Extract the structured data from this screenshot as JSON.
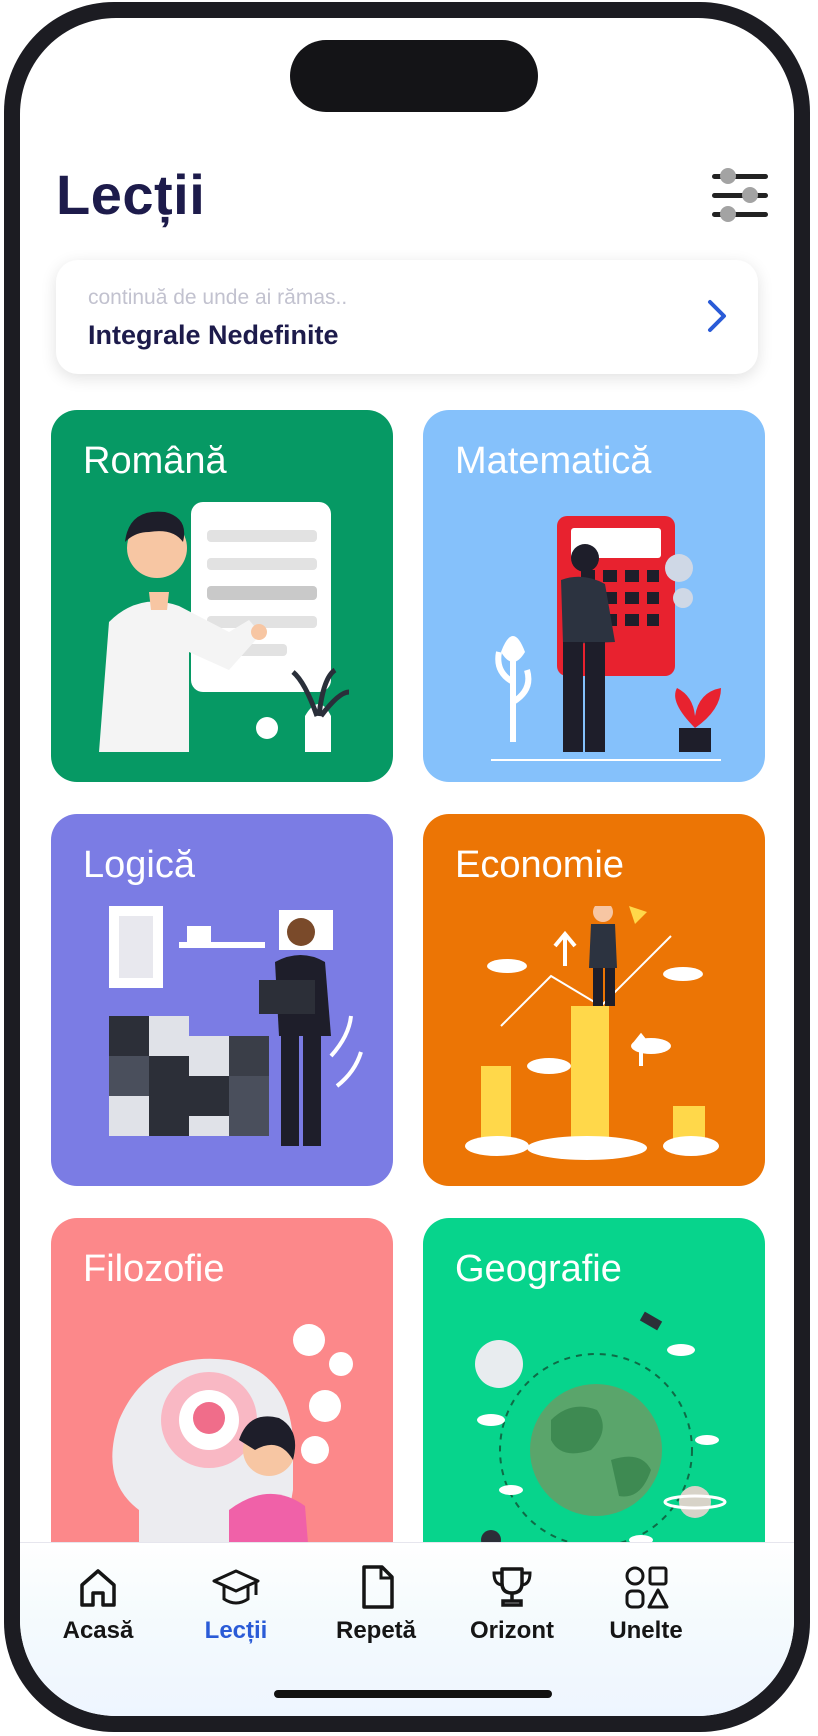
{
  "header": {
    "title": "Lecții"
  },
  "continue": {
    "hint": "continuă de unde ai rămas..",
    "lesson": "Integrale Nedefinite"
  },
  "subjects": [
    {
      "name": "Română",
      "color": "#069964"
    },
    {
      "name": "Matematică",
      "color": "#85c1fb"
    },
    {
      "name": "Logică",
      "color": "#7b7ce4"
    },
    {
      "name": "Economie",
      "color": "#ec7505"
    },
    {
      "name": "Filozofie",
      "color": "#fc888a"
    },
    {
      "name": "Geografie",
      "color": "#07d48c"
    }
  ],
  "nav": {
    "items": [
      {
        "label": "Acasă",
        "icon": "home-icon"
      },
      {
        "label": "Lecții",
        "icon": "graduation-cap-icon",
        "active": true
      },
      {
        "label": "Repetă",
        "icon": "document-icon"
      },
      {
        "label": "Orizont",
        "icon": "trophy-icon"
      },
      {
        "label": "Unelte",
        "icon": "shapes-icon"
      }
    ],
    "active_color": "#2a5bd7"
  }
}
